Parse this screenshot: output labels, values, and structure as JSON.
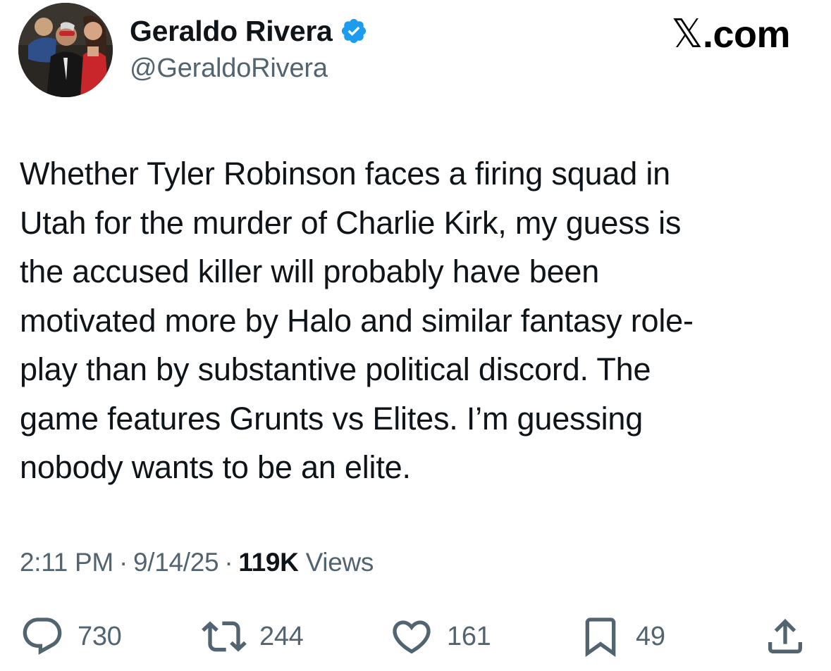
{
  "author": {
    "display_name": "Geraldo Rivera",
    "handle": "@GeraldoRivera",
    "verified": true
  },
  "site_mark": {
    "glyph": "𝕏",
    "text": ".com"
  },
  "tweet": {
    "text": "Whether Tyler Robinson faces a firing squad in\nUtah for the murder of Charlie Kirk, my guess is\nthe accused killer will probably have been\nmotivated more by Halo and similar fantasy role-\nplay than by substantive political discord. The\ngame features Grunts vs Elites. I’m guessing\nnobody wants to be an elite."
  },
  "meta": {
    "time": "2:11 PM",
    "date": "9/14/25",
    "separator": "·",
    "views_count": "119K",
    "views_label": "Views"
  },
  "actions": {
    "replies": "730",
    "reposts": "244",
    "likes": "161",
    "bookmarks": "49"
  },
  "colors": {
    "text_primary": "#0f1419",
    "text_secondary": "#536471",
    "verified_badge": "#1d9bf0"
  },
  "icons": [
    "verified-badge-icon",
    "reply-icon",
    "repost-icon",
    "like-icon",
    "bookmark-icon",
    "share-icon"
  ]
}
